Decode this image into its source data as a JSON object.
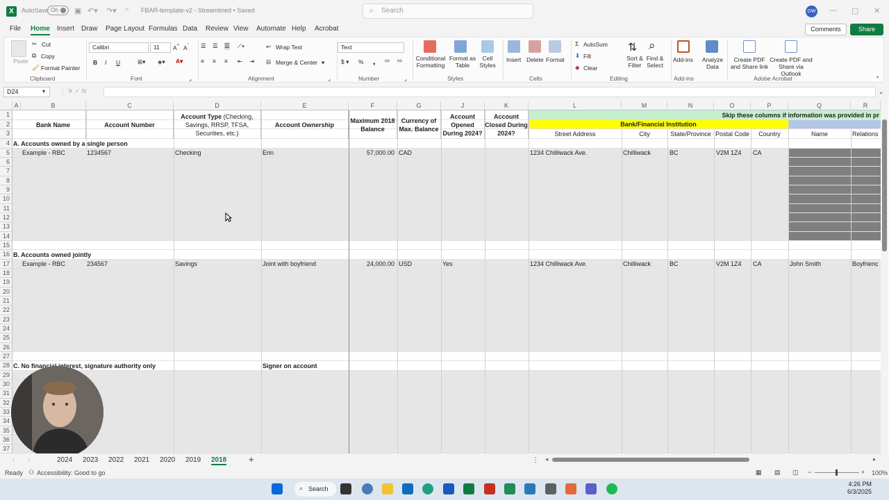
{
  "titlebar": {
    "autosave_label": "AutoSave",
    "autosave_state": "On",
    "title": "FBAR-template-v2 - Streamlined • Saved",
    "search_placeholder": "Search",
    "user_initials": "DW"
  },
  "menu": {
    "items": [
      "File",
      "Home",
      "Insert",
      "Draw",
      "Page Layout",
      "Formulas",
      "Data",
      "Review",
      "View",
      "Automate",
      "Help",
      "Acrobat"
    ],
    "active": "Home",
    "comments": "Comments",
    "share": "Share"
  },
  "ribbon": {
    "clipboard": {
      "paste": "Paste",
      "cut": "Cut",
      "copy": "Copy",
      "format_painter": "Format Painter",
      "group": "Clipboard"
    },
    "font": {
      "name": "Calibri",
      "size": "11",
      "group": "Font"
    },
    "alignment": {
      "wrap": "Wrap Text",
      "merge": "Merge & Center",
      "group": "Alignment"
    },
    "number": {
      "format": "Text",
      "group": "Number"
    },
    "styles": {
      "conditional": "Conditional Formatting",
      "format_table": "Format as Table",
      "cell_styles": "Cell Styles",
      "group": "Styles"
    },
    "cells": {
      "insert": "Insert",
      "delete": "Delete",
      "format": "Format",
      "group": "Cells"
    },
    "editing": {
      "autosum": "AutoSum",
      "fill": "Fill",
      "clear": "Clear",
      "sort": "Sort & Filter",
      "find": "Find & Select",
      "group": "Editing"
    },
    "addins": {
      "addins": "Add-ins",
      "analyze": "Analyze Data",
      "group": "Add-ins"
    },
    "acrobat": {
      "pdf_share": "Create PDF and Share link",
      "pdf_outlook": "Create PDF and Share via Outlook",
      "group": "Adobe Acrobat"
    }
  },
  "formula": {
    "namebox": "D24",
    "fx": "fx",
    "content": ""
  },
  "columns": [
    "A",
    "B",
    "C",
    "D",
    "E",
    "F",
    "G",
    "J",
    "K",
    "L",
    "M",
    "N",
    "O",
    "P",
    "Q",
    "R"
  ],
  "headers": {
    "bank_name": "Bank Name",
    "account_number": "Account Number",
    "account_type_bold": "Account Type",
    "account_type_rest": "(Checking, Savings, RRSP, TFSA, Securities, etc.)",
    "ownership": "Account Ownership",
    "max_balance": "Maximum 2018 Balance",
    "currency": "Currency of Max. Balance",
    "opened": "Account Opened During 2024?",
    "closed": "Account Closed During 2024?",
    "skip_note": "Skip these columns if information was provided in pr",
    "institution": "Bank/Financial Institution",
    "street": "Street Address",
    "city": "City",
    "state": "State/Province",
    "postal": "Postal Code",
    "country": "Country",
    "name": "Name",
    "relations": "Relations"
  },
  "rows": [
    "1",
    "2",
    "3",
    "4",
    "5",
    "6",
    "7",
    "8",
    "9",
    "10",
    "11",
    "12",
    "13",
    "14",
    "15",
    "16",
    "17",
    "18",
    "19",
    "20",
    "21",
    "22",
    "23",
    "24",
    "25",
    "26",
    "27",
    "28",
    "29",
    "30",
    "31",
    "32",
    "33",
    "34",
    "35",
    "36",
    "37"
  ],
  "section_a": {
    "title": "A. Accounts owned by a single person",
    "example": {
      "bank": "Example - RBC",
      "account": "1234567",
      "type": "Checking",
      "owner": "Erin",
      "balance": "57,000.00",
      "currency": "CAD",
      "opened": "",
      "street": "1234 Chilliwack Ave.",
      "city": "Chilliwack",
      "state": "BC",
      "postal": "V2M 1Z4",
      "country": "CA"
    }
  },
  "section_b": {
    "title": "B. Accounts owned jointly",
    "example": {
      "bank": "Example - RBC",
      "account": "234567",
      "type": "Savings",
      "owner": "Joint with boyfriend",
      "balance": "24,000.00",
      "currency": "USD",
      "opened": "Yes",
      "street": "1234 Chilliwack Ave.",
      "city": "Chilliwack",
      "state": "BC",
      "postal": "V2M 1Z4",
      "country": "CA",
      "name": "John Smith",
      "relation": "Boyfrienc"
    }
  },
  "section_c": {
    "title": "C. No financial interest, signature authority only",
    "signer": "Signer on account"
  },
  "sheets": [
    "2024",
    "2023",
    "2022",
    "2021",
    "2020",
    "2019",
    "2018"
  ],
  "active_sheet": "2018",
  "status": {
    "ready": "Ready",
    "accessibility": "Accessibility: Good to go",
    "zoom": "100%"
  },
  "taskbar": {
    "search": "Search",
    "time": "4:26 PM",
    "date": "6/3/2025"
  },
  "colors": {
    "excel_green": "#107c41",
    "yellow_header": "#ffff00",
    "green_band": "#c6efce",
    "blue_band": "#b4c6e7",
    "gray_fill": "#7f7f7f"
  }
}
